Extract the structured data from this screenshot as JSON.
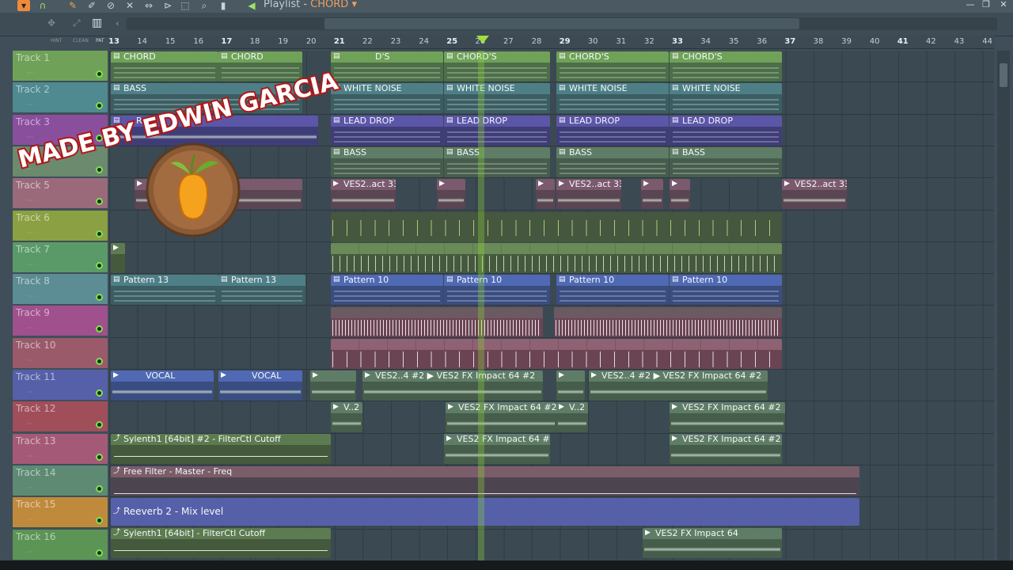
{
  "window": {
    "title_prefix": "Playlist - ",
    "pattern_name": "CHORD",
    "dropdown_arrow": "▾"
  },
  "toolbar": {
    "labels": [
      "HINT",
      "CLEAN",
      "PAT"
    ],
    "icons": [
      "pencil-icon",
      "brush-icon",
      "delete-icon",
      "mute-icon",
      "slip-icon",
      "slice-icon",
      "select-icon",
      "zoom-icon",
      "playback-icon",
      "piano-roll-icon"
    ]
  },
  "ruler": {
    "bars": [
      "13",
      "14",
      "15",
      "16",
      "17",
      "18",
      "19",
      "20",
      "21",
      "22",
      "23",
      "24",
      "25",
      "26",
      "27",
      "28",
      "29",
      "30",
      "31",
      "32",
      "33",
      "34",
      "35",
      "36",
      "37",
      "38",
      "39",
      "40",
      "41",
      "42",
      "43",
      "44"
    ],
    "major_bars": [
      "13",
      "17",
      "21",
      "25",
      "29",
      "33",
      "37",
      "41"
    ]
  },
  "watermark": {
    "line1": "MADE BY EDWIN GARCIA"
  },
  "tracks": [
    {
      "name": "Track 1",
      "color": "#6fa258"
    },
    {
      "name": "Track 2",
      "color": "#4e8a90"
    },
    {
      "name": "Track 3",
      "color": "#8a4f9c"
    },
    {
      "name": "Track 4",
      "color": "#6b8a6e"
    },
    {
      "name": "Track 5",
      "color": "#9a6a7a"
    },
    {
      "name": "Track 6",
      "color": "#8aa043"
    },
    {
      "name": "Track 7",
      "color": "#5a9a68"
    },
    {
      "name": "Track 8",
      "color": "#5c8c94"
    },
    {
      "name": "Track 9",
      "color": "#a0508c"
    },
    {
      "name": "Track 10",
      "color": "#9a5a6a"
    },
    {
      "name": "Track 11",
      "color": "#5660a8"
    },
    {
      "name": "Track 12",
      "color": "#a04e5a"
    },
    {
      "name": "Track 13",
      "color": "#a45a76"
    },
    {
      "name": "Track 14",
      "color": "#5e8a74"
    },
    {
      "name": "Track 15",
      "color": "#c08a3c"
    },
    {
      "name": "Track 16",
      "color": "#5c9456"
    }
  ],
  "clips": {
    "chord": "CHORD",
    "chords": "CHORD'S",
    "chords_partial": "D'S",
    "bass": "BASS",
    "white_noise": "WHITE NOISE",
    "lead_drop": "LEAD DROP",
    "lead_partial": "R",
    "ves_act": "VES2..act 33",
    "pattern13": "Pattern 13",
    "pattern10": "Pattern 10",
    "vocal": "VOCAL",
    "ves_impact_partial": "VES2..4 #2",
    "ves_impact": "VES2 FX Impact 64 #2",
    "ves_impact_plain": "VES2 FX Impact 64",
    "v2": "V..2",
    "syn_filter2": "Sylenth1 [64bit] #2 - FilterCtl Cutoff",
    "free_filter": "Free Filter - Master - Freq",
    "reverb": "Reeverb 2 - Mix level",
    "syn_filter": "Sylenth1 [64bit] - FilterCtl Cutoff"
  }
}
